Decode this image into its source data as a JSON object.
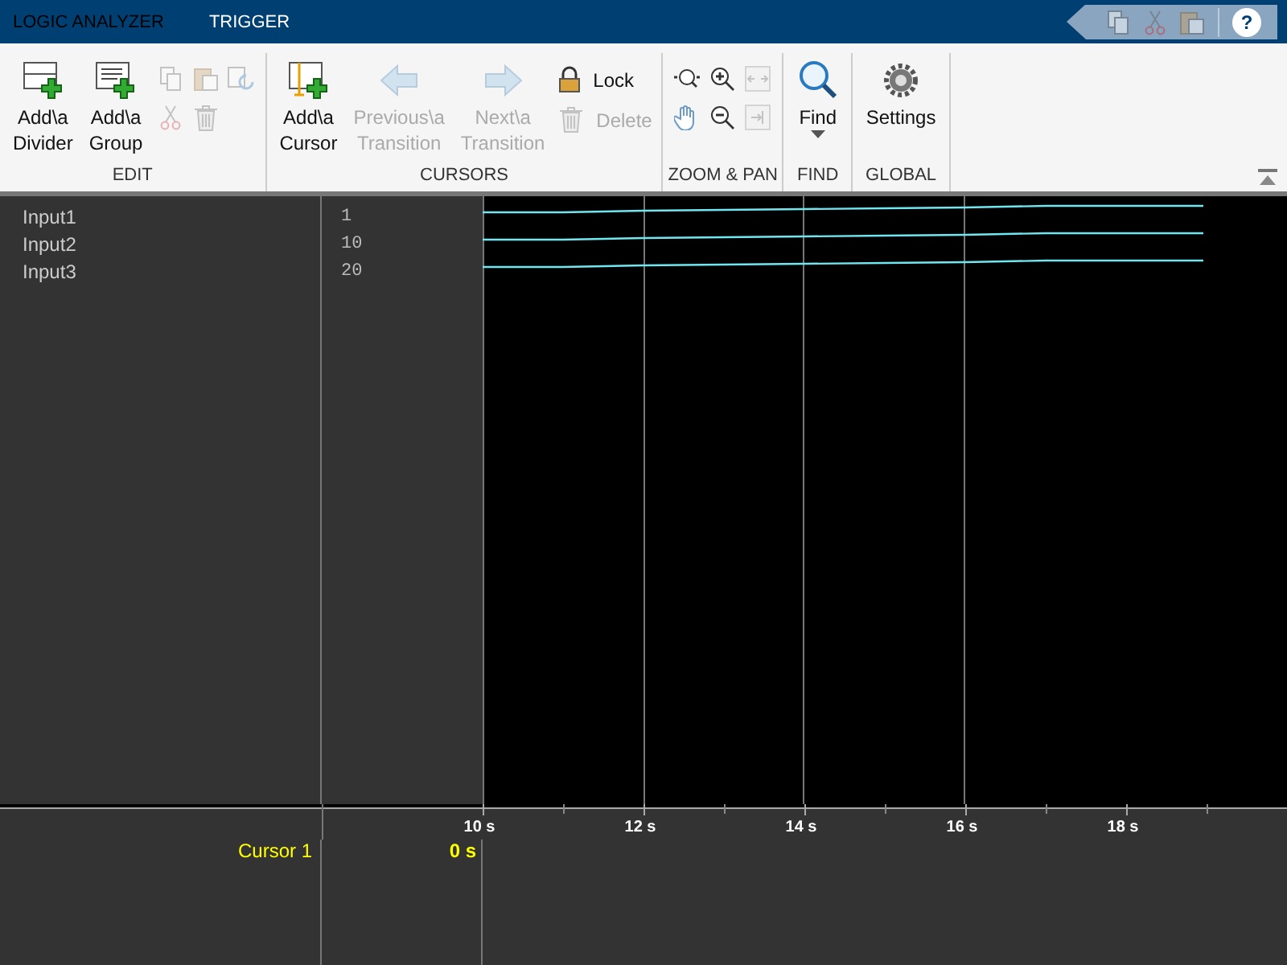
{
  "tabs": [
    {
      "label": "LOGIC ANALYZER",
      "selected": false
    },
    {
      "label": "TRIGGER",
      "selected": true
    }
  ],
  "quick_access": [
    {
      "kind": "copy",
      "disabled": true
    },
    {
      "kind": "cut",
      "disabled": true
    },
    {
      "kind": "paste",
      "disabled": true
    },
    {
      "kind": "help",
      "label": "?"
    }
  ],
  "toolstrip": {
    "sections": [
      {
        "label": "EDIT",
        "items": [
          {
            "kind": "large",
            "lines": [
              "Add\\a",
              "Divider"
            ],
            "disabled": false
          },
          {
            "kind": "large",
            "lines": [
              "Add\\a",
              "Group"
            ],
            "disabled": false
          },
          {
            "kind": "grid",
            "cells": [
              {
                "disabled": true
              },
              {
                "disabled": true
              },
              {
                "disabled": true
              },
              {
                "disabled": true
              },
              {
                "disabled": true
              }
            ]
          }
        ]
      },
      {
        "label": "CURSORS",
        "items": [
          {
            "kind": "large",
            "lines": [
              "Add\\a",
              "Cursor"
            ],
            "disabled": false
          },
          {
            "kind": "large",
            "lines": [
              "Previous\\a",
              "Transition"
            ],
            "disabled": true
          },
          {
            "kind": "large",
            "lines": [
              "Next\\a",
              "Transition"
            ],
            "disabled": true
          },
          {
            "kind": "list",
            "rows": [
              {
                "label": "Lock",
                "disabled": false
              },
              {
                "label": "Delete",
                "disabled": true
              }
            ]
          }
        ]
      },
      {
        "label": "ZOOM & PAN",
        "items": [
          {
            "kind": "grid",
            "cells": [
              {
                "disabled": false
              },
              {
                "disabled": false
              },
              {
                "disabled": true
              },
              {
                "disabled": false
              },
              {
                "disabled": false
              },
              {
                "disabled": true
              }
            ]
          }
        ]
      },
      {
        "label": "FIND",
        "items": [
          {
            "kind": "large",
            "lines": [
              "Find"
            ],
            "dropdown": true,
            "disabled": false
          }
        ]
      },
      {
        "label": "GLOBAL",
        "items": [
          {
            "kind": "large",
            "lines": [
              "Settings"
            ],
            "disabled": false
          }
        ]
      }
    ]
  },
  "signals": [
    {
      "name": "Input1",
      "value": "1"
    },
    {
      "name": "Input2",
      "value": "10"
    },
    {
      "name": "Input3",
      "value": "20"
    }
  ],
  "time_axis": {
    "ticks": [
      "10 s",
      "12 s",
      "14 s",
      "16 s",
      "18 s"
    ]
  },
  "cursor": {
    "label": "Cursor 1",
    "value": "0 s"
  }
}
